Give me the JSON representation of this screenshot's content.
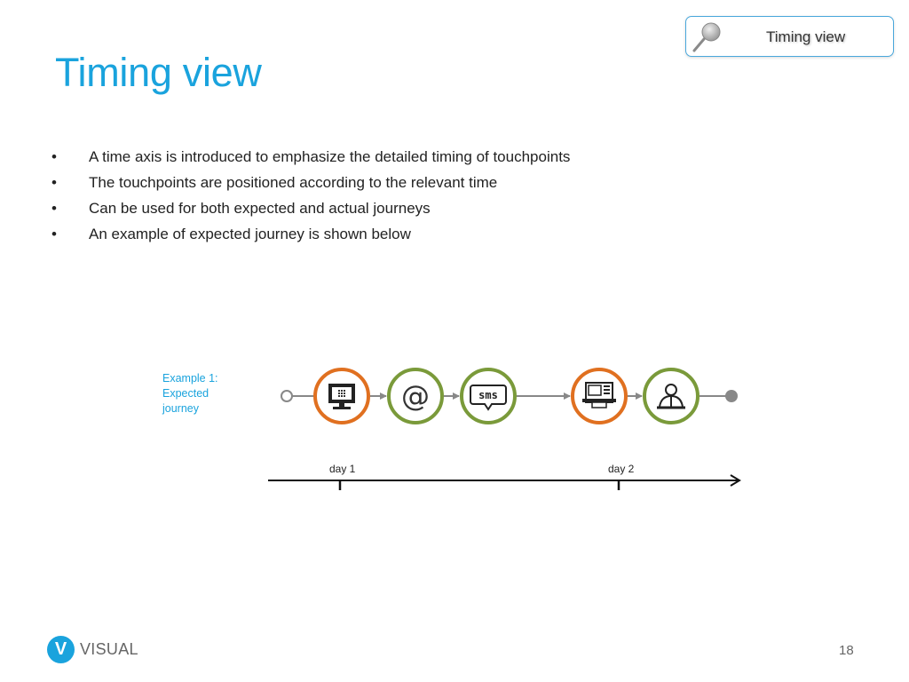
{
  "badge": {
    "label": "Timing view",
    "icon": "magnifier-icon"
  },
  "title": "Timing view",
  "bullets": [
    {
      "marker": "•",
      "text": "A time axis is introduced to emphasize the detailed timing of touchpoints"
    },
    {
      "marker": "•",
      "text": "The touchpoints are positioned according to the relevant time"
    },
    {
      "marker": "•",
      "text": "Can be used for both expected and actual journeys"
    },
    {
      "marker": "•",
      "text": "An example of expected journey is shown below"
    }
  ],
  "example": {
    "label_lines": [
      "Example 1:",
      "Expected",
      "journey"
    ],
    "touchpoints": [
      {
        "name": "computer",
        "icon": "computer-monitor-icon",
        "color": "#e07020"
      },
      {
        "name": "email",
        "icon": "at-sign-icon",
        "color": "#7a9a3a"
      },
      {
        "name": "sms",
        "icon": "sms-bubble-icon",
        "color": "#7a9a3a",
        "text": "sms"
      },
      {
        "name": "atm",
        "icon": "atm-machine-icon",
        "color": "#e07020"
      },
      {
        "name": "agent",
        "icon": "person-agent-icon",
        "color": "#7a9a3a"
      }
    ],
    "start_node": "open-circle",
    "end_node": "filled-circle"
  },
  "time_axis": {
    "ticks": [
      "day 1",
      "day 2"
    ]
  },
  "colors": {
    "accent_blue": "#1aa3dd",
    "orange": "#e07020",
    "green": "#7a9a3a",
    "connector": "#888888"
  },
  "footer": {
    "logo_letter": "V",
    "logo_text": "VISUAL",
    "page_number": "18"
  }
}
